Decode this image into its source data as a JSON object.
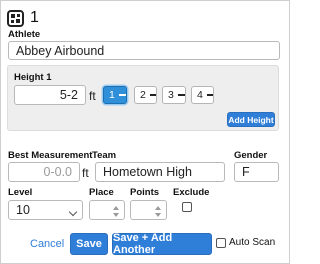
{
  "header": {
    "athlete_number": "1",
    "icon": "qr-code-icon"
  },
  "athlete": {
    "label": "Athlete",
    "value": "Abbey Airbound"
  },
  "height_panel": {
    "label": "Height 1",
    "value": "5-2",
    "unit": "ft",
    "attempts": [
      {
        "label": "1",
        "active": true
      },
      {
        "label": "2",
        "active": false
      },
      {
        "label": "3",
        "active": false
      },
      {
        "label": "4",
        "active": false
      }
    ],
    "add_button": "Add Height"
  },
  "best_measurement": {
    "label": "Best Measurement",
    "value": "0-0.0",
    "unit": "ft"
  },
  "team": {
    "label": "Team",
    "value": "Hometown High"
  },
  "gender": {
    "label": "Gender",
    "value": "F"
  },
  "level": {
    "label": "Level",
    "value": "10"
  },
  "place": {
    "label": "Place",
    "value": ""
  },
  "points": {
    "label": "Points",
    "value": ""
  },
  "exclude": {
    "label": "Exclude",
    "checked": false
  },
  "footer": {
    "cancel": "Cancel",
    "save": "Save",
    "save_add": "Save + Add Another",
    "auto_scan": "Auto Scan",
    "auto_scan_checked": false
  },
  "colors": {
    "primary": "#2f7ed8",
    "active_attempt": "#2f8fd8",
    "panel_bg": "#eeeeee"
  }
}
